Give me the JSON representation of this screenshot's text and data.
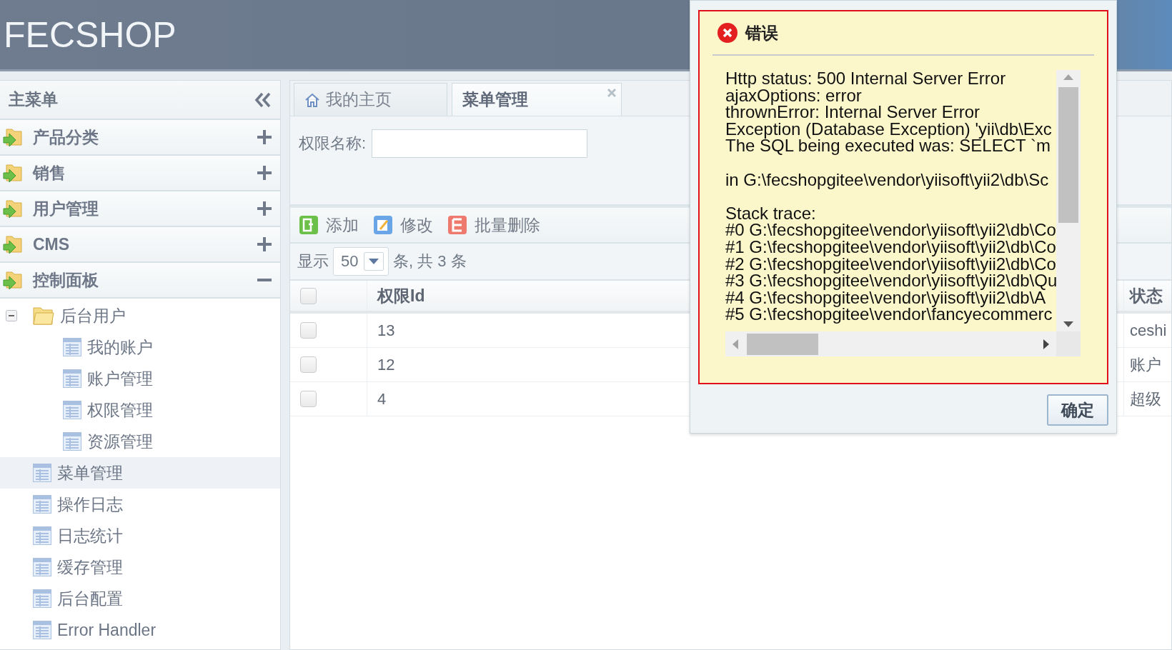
{
  "header": {
    "logo": "FECSHOP"
  },
  "sidebar": {
    "title": "主菜单",
    "groups": [
      {
        "label": "产品分类",
        "expanded": false
      },
      {
        "label": "销售",
        "expanded": false
      },
      {
        "label": "用户管理",
        "expanded": false
      },
      {
        "label": "CMS",
        "expanded": false
      },
      {
        "label": "控制面板",
        "expanded": true
      }
    ],
    "tree": [
      {
        "label": "后台用户",
        "kind": "folder",
        "expanded": true,
        "selected": false,
        "children": [
          {
            "label": "我的账户",
            "kind": "page",
            "selected": false
          },
          {
            "label": "账户管理",
            "kind": "page",
            "selected": false
          },
          {
            "label": "权限管理",
            "kind": "page",
            "selected": false
          },
          {
            "label": "资源管理",
            "kind": "page",
            "selected": false
          }
        ]
      },
      {
        "label": "菜单管理",
        "kind": "page",
        "selected": true
      },
      {
        "label": "操作日志",
        "kind": "page",
        "selected": false
      },
      {
        "label": "日志统计",
        "kind": "page",
        "selected": false
      },
      {
        "label": "缓存管理",
        "kind": "page",
        "selected": false
      },
      {
        "label": "后台配置",
        "kind": "page",
        "selected": false
      },
      {
        "label": "Error Handler",
        "kind": "page",
        "selected": false
      }
    ]
  },
  "tabs": [
    {
      "label": "我的主页",
      "kind": "home",
      "selected": false
    },
    {
      "label": "菜单管理",
      "kind": "closable",
      "selected": true
    }
  ],
  "search": {
    "label": "权限名称:"
  },
  "toolbar": [
    {
      "label": "添加",
      "kind": "add"
    },
    {
      "label": "修改",
      "kind": "edit"
    },
    {
      "label": "批量删除",
      "kind": "delete"
    }
  ],
  "pager": {
    "prefix": "显示",
    "page_size": "50",
    "suffix": "条, 共 3 条"
  },
  "table": {
    "columns": [
      "权限Id",
      "状态"
    ],
    "header_checked": false,
    "rows": [
      {
        "checked": false,
        "cells": [
          "13",
          "ceshi"
        ]
      },
      {
        "checked": false,
        "cells": [
          "12",
          "账户"
        ]
      },
      {
        "checked": false,
        "cells": [
          "4",
          "超级"
        ]
      }
    ]
  },
  "dialog": {
    "title": "错误",
    "button": "确定",
    "paragraphs": [
      [
        "Http status: 500 Internal Server Error",
        "ajaxOptions: error",
        "thrownError: Internal Server Error",
        "Exception (Database Exception) 'yii\\db\\Exc",
        "The SQL being executed was: SELECT `m"
      ],
      [
        "in G:\\fecshopgitee\\vendor\\yiisoft\\yii2\\db\\Sc"
      ],
      [
        "Stack trace:",
        "#0 G:\\fecshopgitee\\vendor\\yiisoft\\yii2\\db\\Co",
        "#1 G:\\fecshopgitee\\vendor\\yiisoft\\yii2\\db\\Co",
        "#2 G:\\fecshopgitee\\vendor\\yiisoft\\yii2\\db\\Co",
        "#3 G:\\fecshopgitee\\vendor\\yiisoft\\yii2\\db\\Qu",
        "#4 G:\\fecshopgitee\\vendor\\yiisoft\\yii2\\db\\A",
        "#5 G:\\fecshopgitee\\vendor\\fancyecommerc"
      ]
    ]
  }
}
